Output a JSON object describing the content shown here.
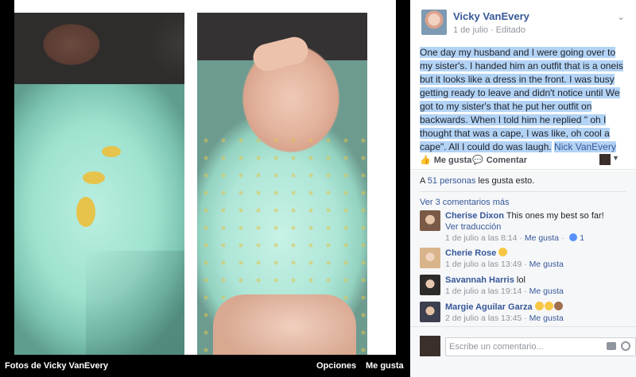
{
  "caption_bar": {
    "title": "Fotos de Vicky VanEvery",
    "options_label": "Opciones",
    "like_label": "Me gusta"
  },
  "post": {
    "author": "Vicky VanEvery",
    "date": "1 de julio",
    "separator": "·",
    "edited": "Editado",
    "menu_icon": "chevron-down-icon",
    "text": "One day my husband and I were going over to my sister's. I handed him an outfit that is a oneis but it looks like a dress in the front. I was busy getting ready to leave and didn't notice until We got to my sister's that he put her outfit on backwards. When I told him he replied \" oh I thought that was a cape, I was like, oh cool a cape\". All I could do was laugh.",
    "tagged": "Nick VanEvery"
  },
  "actions": {
    "like": "Me gusta",
    "comment": "Comentar",
    "caret": "▼"
  },
  "likes": {
    "prefix": "A",
    "count_link": "51 personas",
    "suffix": "les gusta esto."
  },
  "more_comments": "Ver 3 comentarios más",
  "comments": [
    {
      "name": "Cherise Dixon",
      "text": "This ones my best so far!",
      "translate": "Ver traducción",
      "date": "1 de julio a las 8:14",
      "like": "Me gusta",
      "likes_count": "1"
    },
    {
      "name": "Cherie Rose",
      "text": "",
      "date": "1 de julio a las 13:49",
      "like": "Me gusta"
    },
    {
      "name": "Savannah Harris",
      "text": "lol",
      "date": "1 de julio a las 19:14",
      "like": "Me gusta"
    },
    {
      "name": "Margie Aguilar Garza",
      "text": "",
      "date": "2 de julio a las 13:45",
      "like": "Me gusta"
    }
  ],
  "composer": {
    "placeholder": "Escribe un comentario..."
  },
  "colors": {
    "link": "#365899",
    "selection": "#b3d3f5",
    "muted": "#90949c"
  }
}
